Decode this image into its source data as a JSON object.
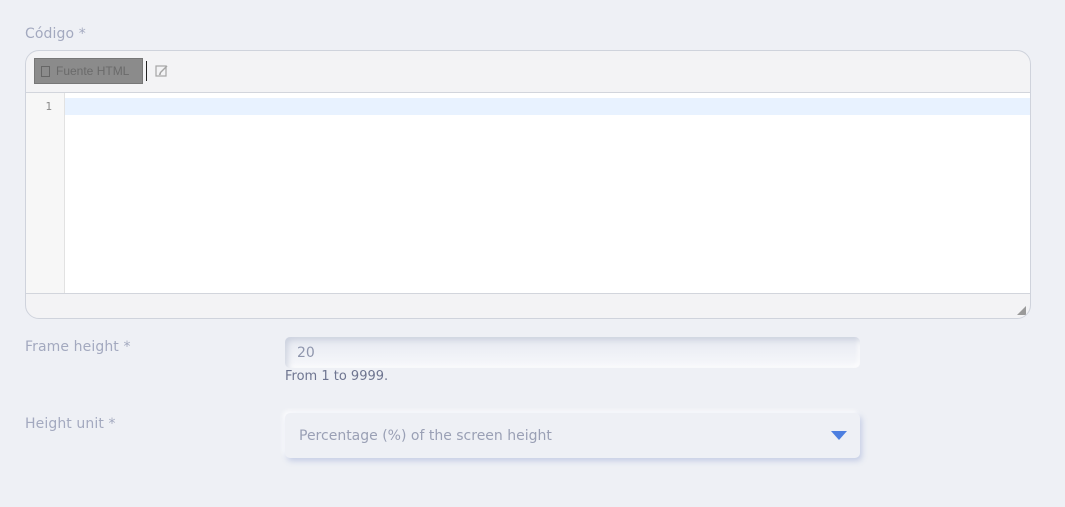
{
  "code_field": {
    "label": "Código *",
    "toolbar": {
      "source_button_label": "Fuente HTML"
    },
    "editor": {
      "line_numbers": [
        "1"
      ]
    }
  },
  "frame_height": {
    "label": "Frame height *",
    "value": "20",
    "help": "From 1 to 9999."
  },
  "height_unit": {
    "label": "Height unit *",
    "selected": "Percentage (%) of the screen height"
  },
  "colors": {
    "background": "#eef0f5",
    "accent": "#4d7fe0"
  }
}
